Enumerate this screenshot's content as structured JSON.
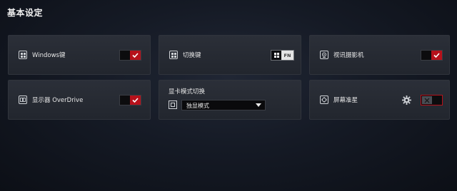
{
  "page": {
    "title": "基本设定"
  },
  "cards": {
    "windows_key": {
      "label": "Windows键",
      "state": "on"
    },
    "switch_key": {
      "label": "切换键",
      "fn_label": "FN",
      "state": "windows"
    },
    "webcam": {
      "label": "视讯摄影机",
      "state": "on"
    },
    "overdrive": {
      "label": "显示器 OverDrive",
      "state": "on"
    },
    "gpu_mode": {
      "label": "显卡模式切换",
      "selected": "独显模式"
    },
    "crosshair": {
      "label": "屏幕准星",
      "state": "off"
    }
  },
  "colors": {
    "accent": "#b6111b",
    "card_bg": "#262a32",
    "background": "#151a25"
  }
}
